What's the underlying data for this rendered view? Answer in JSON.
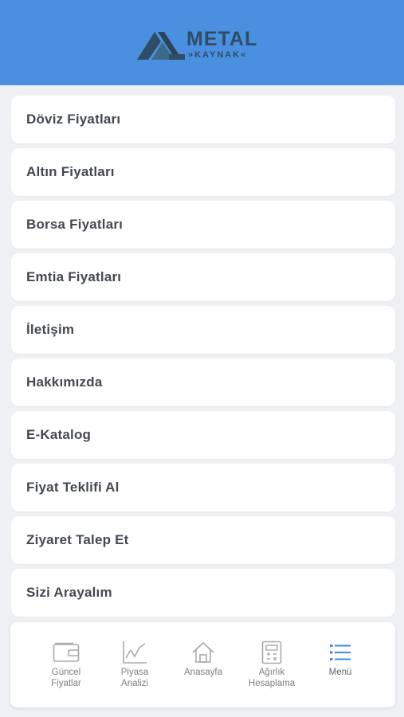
{
  "header": {
    "logo_word": "METAL",
    "logo_sub": "»KAYNAK«",
    "background": "#4a8fe0"
  },
  "menu": {
    "items": [
      {
        "label": "Döviz Fiyatları"
      },
      {
        "label": "Altın Fiyatları"
      },
      {
        "label": "Borsa Fiyatları"
      },
      {
        "label": "Emtia Fiyatları"
      },
      {
        "label": "İletişim"
      },
      {
        "label": "Hakkımızda"
      },
      {
        "label": "E-Katalog"
      },
      {
        "label": "Fiyat Teklifi Al"
      },
      {
        "label": "Ziyaret Talep Et"
      },
      {
        "label": "Sizi Arayalım"
      }
    ]
  },
  "bottom_nav": {
    "items": [
      {
        "label": "Güncel\nFiyatlar",
        "icon": "wallet-icon"
      },
      {
        "label": "Piyasa\nAnalizi",
        "icon": "chart-line-icon"
      },
      {
        "label": "Anasayfa",
        "icon": "home-icon"
      },
      {
        "label": "Ağırlık\nHesaplama",
        "icon": "calculator-icon"
      },
      {
        "label": "Menü",
        "icon": "list-icon",
        "active": true
      }
    ],
    "active_color": "#3f8be0"
  }
}
